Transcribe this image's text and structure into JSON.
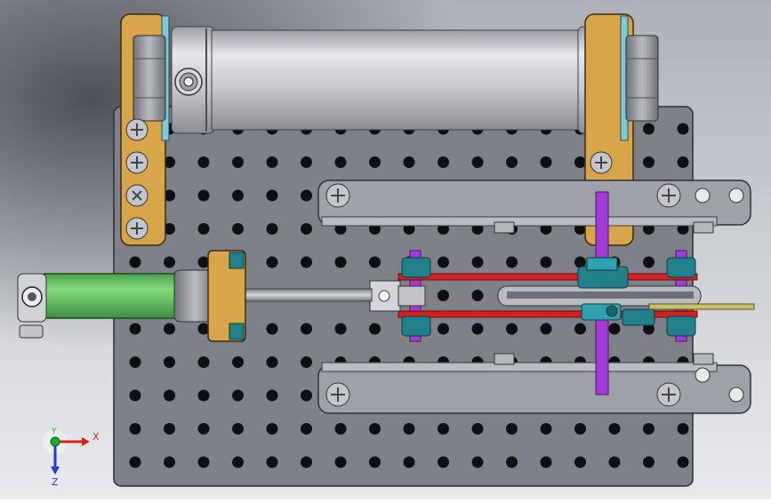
{
  "viewport": {
    "background_top": "#aeb2b8",
    "background_mid": "#c9ccd1",
    "background_bottom": "#e9eaec"
  },
  "triad": {
    "x_label": "X",
    "y_label": "Y",
    "z_label": "Z",
    "x_color": "#d81e1e",
    "y_color": "#1faa2e",
    "z_color": "#1f3bd8"
  },
  "colors": {
    "base_plate": "#7f8188",
    "brass_bracket": "#d8a54a",
    "cylinder_body": "#c8cace",
    "air_cylinder": "#5fc45c",
    "red_rail": "#d42020",
    "teal_block": "#21808a",
    "purple_shaft": "#a23ad6",
    "steel_bar": "#9ea2a8"
  }
}
